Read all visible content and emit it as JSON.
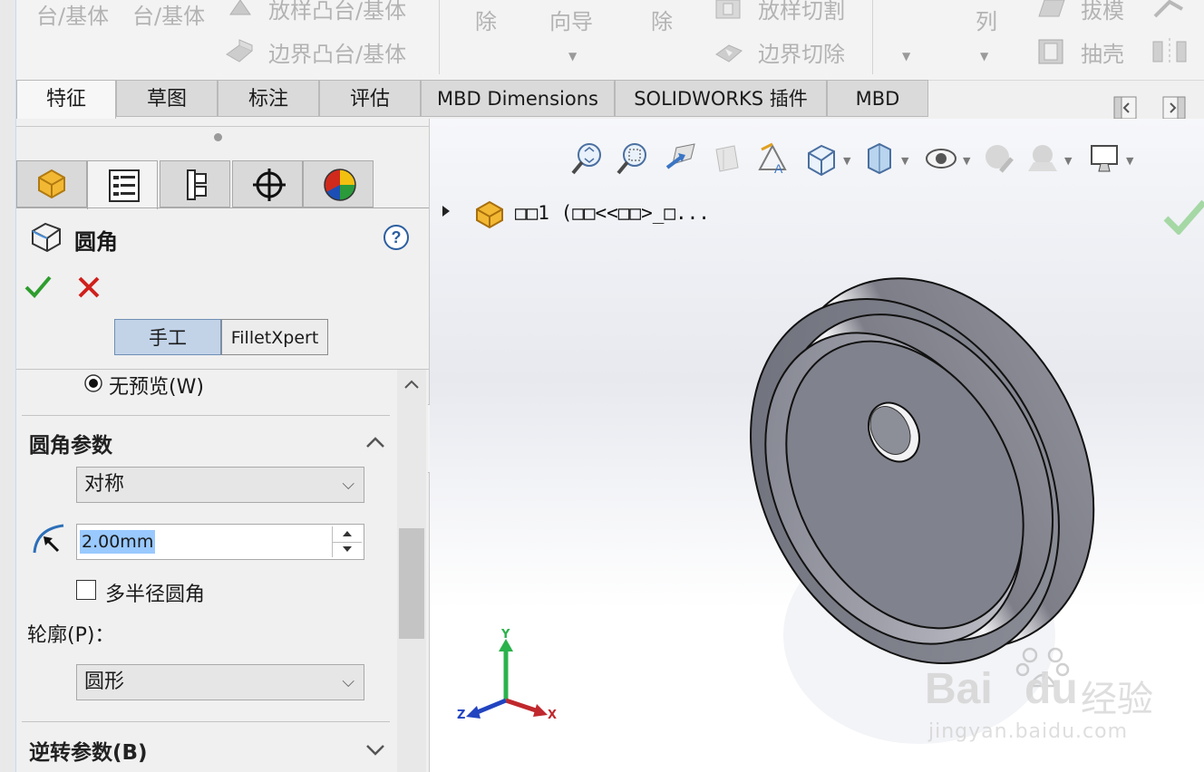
{
  "ribbon": {
    "row1": [
      "台/基体",
      "台/基体",
      "放样凸台/基体",
      "除",
      "向导",
      "除",
      "放样切割",
      "列",
      "拔模"
    ],
    "row2": [
      "边界凸台/基体",
      "边界切除",
      "抽壳"
    ]
  },
  "tabs": [
    {
      "label": "特征",
      "active": true
    },
    {
      "label": "草图",
      "active": false
    },
    {
      "label": "标注",
      "active": false
    },
    {
      "label": "评估",
      "active": false
    },
    {
      "label": "MBD Dimensions",
      "active": false
    },
    {
      "label": "SOLIDWORKS 插件",
      "active": false
    },
    {
      "label": "MBD",
      "active": false
    }
  ],
  "property_manager": {
    "title": "圆角",
    "tab_icons": [
      "feature-manager-icon",
      "property-manager-icon",
      "configuration-manager-icon",
      "dimxpert-icon",
      "display-manager-icon"
    ],
    "modes": {
      "manual": "手工",
      "expert": "FilletXpert"
    },
    "no_preview": "无预览(W)",
    "fillet_params": {
      "title": "圆角参数",
      "type_value": "对称",
      "radius": "2.00mm",
      "multi_radius": "多半径圆角",
      "profile_label": "轮廓(P)：",
      "profile_value": "圆形"
    },
    "reverse_params_title": "逆转参数(B)"
  },
  "feature_tree": {
    "item": "□□1  (□□<<□□>_□..."
  },
  "triad": {
    "x": "X",
    "y": "Y",
    "z": "Z"
  },
  "watermark": {
    "brand": "Bai",
    "brand2": "du",
    "suffix": "经验",
    "url": "jingyan.baidu.com"
  },
  "colors": {
    "accept": "#2e9d2e",
    "cancel": "#d0201b",
    "selection_highlight": "#99c9ff",
    "axis_x": "#c0282d",
    "axis_y": "#2bb24c",
    "axis_z": "#2244c0"
  }
}
